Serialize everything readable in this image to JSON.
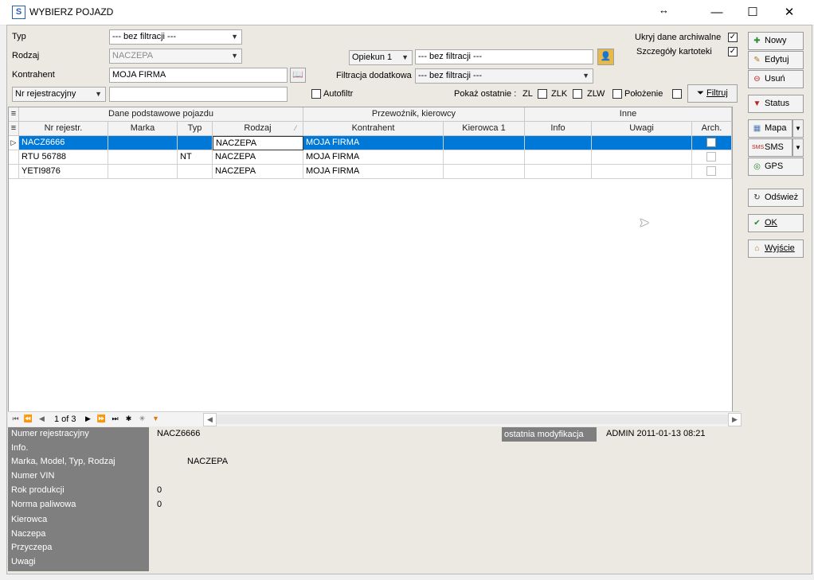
{
  "window": {
    "title": "WYBIERZ POJAZD",
    "resize_hint": "↔"
  },
  "filters": {
    "typ_label": "Typ",
    "typ_value": "--- bez filtracji ---",
    "rodzaj_label": "Rodzaj",
    "rodzaj_value": "NACZEPA",
    "kontrahent_label": "Kontrahent",
    "kontrahent_value": "MOJA FIRMA",
    "search_field_value": "Nr rejestracyjny",
    "search_text": "",
    "opiekun_value": "Opiekun 1",
    "opiekun_filter_value": "--- bez filtracji ---",
    "filtracja_label": "Filtracja dodatkowa",
    "filtracja_value": "--- bez filtracji ---",
    "ukryj_label": "Ukryj dane archiwalne",
    "ukryj_checked": "✓",
    "szczegoly_label": "Szczegóły kartoteki",
    "szczegoly_checked": "✓",
    "autofiltr_label": "Autofiltr",
    "pokaz_label": "Pokaż ostatnie :",
    "zl_label": "ZL",
    "zlk_label": "ZLK",
    "zlw_label": "ZLW",
    "polozenie_label": "Położenie",
    "filtruj_label": "Filtruj"
  },
  "side_buttons": {
    "nowy": "Nowy",
    "edytuj": "Edytuj",
    "usun": "Usuń",
    "status": "Status",
    "mapa": "Mapa",
    "sms": "SMS",
    "gps": "GPS",
    "odswiez": "Odśwież",
    "ok": "OK",
    "wyjscie": "Wyjście"
  },
  "grid": {
    "groups": [
      "Dane podstawowe pojazdu",
      "Przewoźnik, kierowcy",
      "Inne"
    ],
    "columns": [
      "Nr rejestr.",
      "Marka",
      "Typ",
      "Rodzaj",
      "Kontrahent",
      "Kierowca 1",
      "Info",
      "Uwagi",
      "Arch."
    ],
    "rows": [
      {
        "nr": "NACZ6666",
        "marka": "",
        "typ": "",
        "rodzaj": "NACZEPA",
        "kontrahent": "MOJA FIRMA",
        "kierowca": "",
        "info": "",
        "uwagi": ""
      },
      {
        "nr": "RTU 56788",
        "marka": "",
        "typ": "NT",
        "rodzaj": "NACZEPA",
        "kontrahent": "MOJA FIRMA",
        "kierowca": "",
        "info": "",
        "uwagi": ""
      },
      {
        "nr": "YETI9876",
        "marka": "",
        "typ": "",
        "rodzaj": "NACZEPA",
        "kontrahent": "MOJA FIRMA",
        "kierowca": "",
        "info": "",
        "uwagi": ""
      }
    ],
    "pager": "1 of 3"
  },
  "detail": {
    "labels": [
      "Numer rejestracyjny",
      "Info.",
      "Marka, Model, Typ, Rodzaj",
      "Numer VIN",
      "Rok produkcji",
      "Norma paliwowa",
      "Kierowca",
      "Naczepa",
      "Przyczepa",
      "Uwagi"
    ],
    "nr_value": "NACZ6666",
    "marka_value": "NACZEPA",
    "rok_value": "0",
    "norma_value": "0",
    "modyfikacja_label": "ostatnia modyfikacja",
    "modyfikacja_value": "ADMIN 2011-01-13 08:21"
  }
}
